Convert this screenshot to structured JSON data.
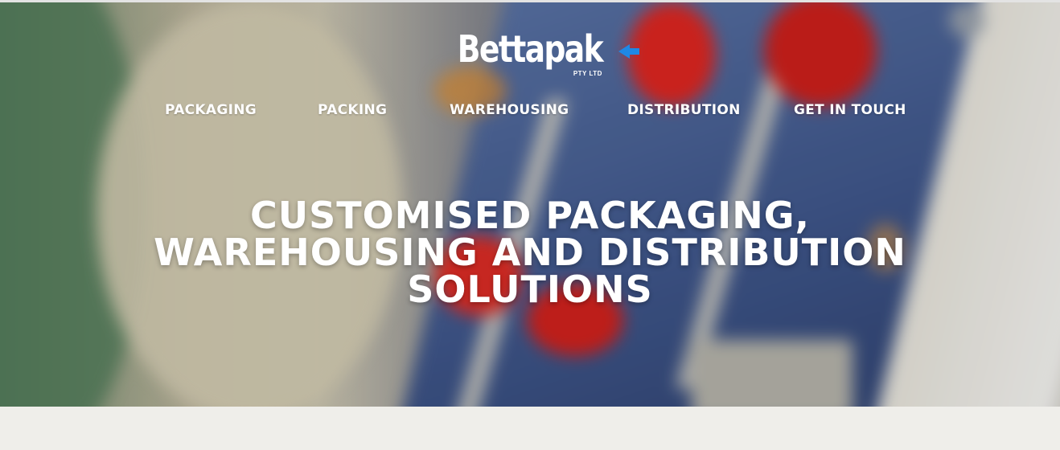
{
  "brand": {
    "name": "Bettapak",
    "suffix": "PTY LTD",
    "accent_color": "#1e88e5"
  },
  "nav": {
    "items": [
      {
        "label": "PACKAGING"
      },
      {
        "label": "PACKING"
      },
      {
        "label": "WAREHOUSING"
      },
      {
        "label": "DISTRIBUTION"
      },
      {
        "label": "GET IN TOUCH"
      }
    ]
  },
  "hero": {
    "headline_lines": [
      "CUSTOMISED PACKAGING,",
      "WAREHOUSING AND DISTRIBUTION",
      "SOLUTIONS"
    ]
  },
  "colors": {
    "text": "#ffffff",
    "page_background": "#efeeea",
    "panel_blue": "#4a5f86",
    "button_red": "#e0201a"
  },
  "icons": {
    "logo_arrow": "arrow-left-icon"
  }
}
